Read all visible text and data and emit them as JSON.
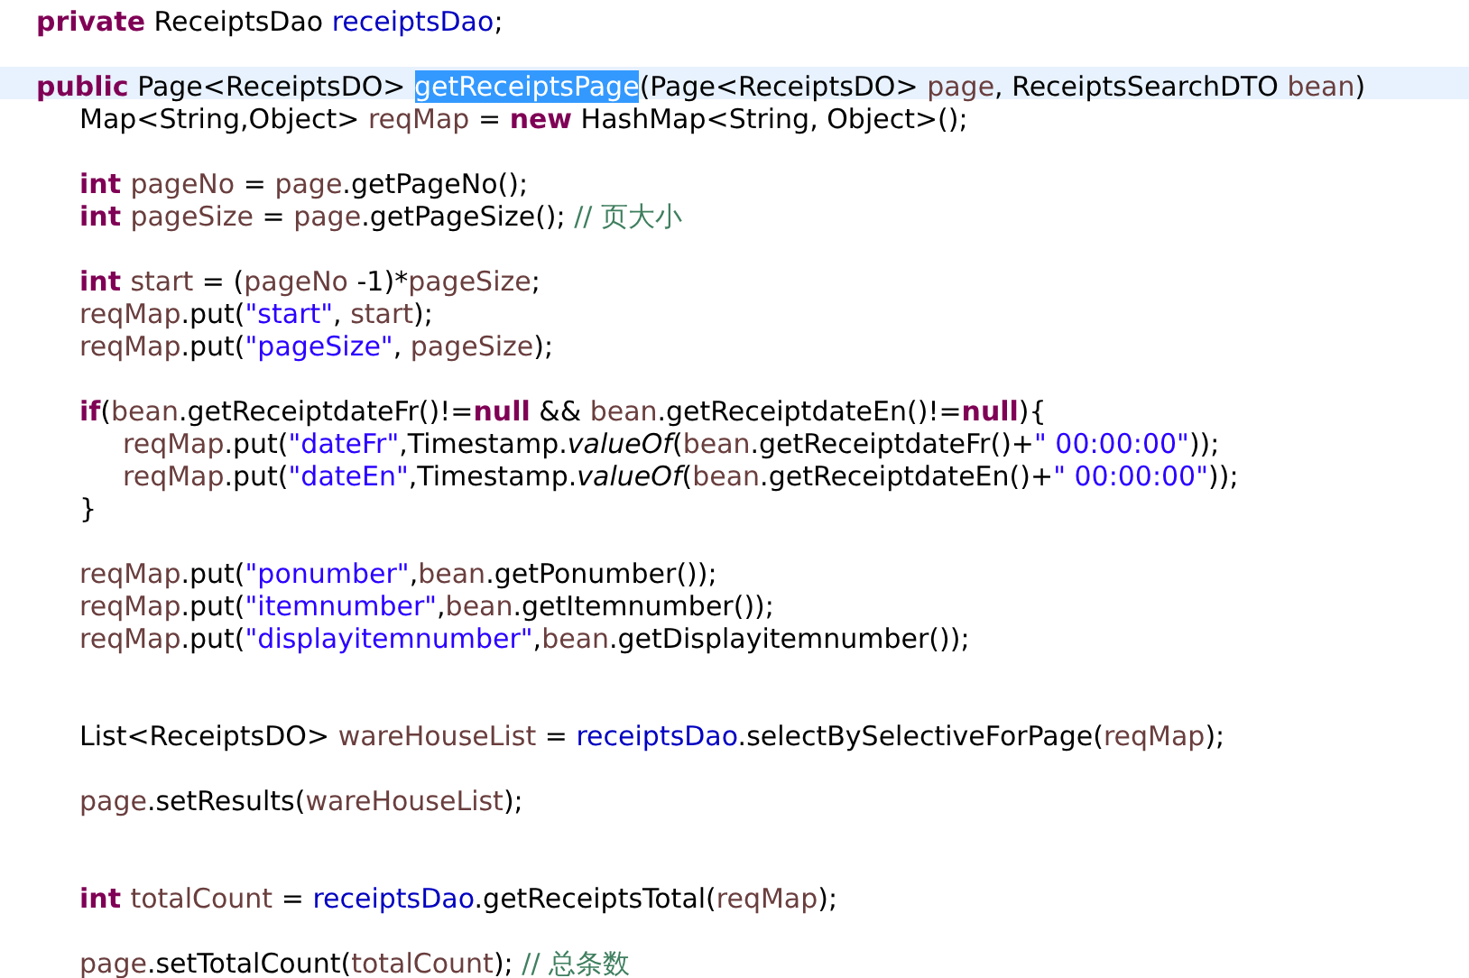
{
  "editor": {
    "lines": [
      {
        "kind": "code",
        "current": false,
        "tokens": [
          {
            "kind": "keyword",
            "text": "private"
          },
          {
            "kind": "plain",
            "text": " ReceiptsDao "
          },
          {
            "kind": "field",
            "text": "receiptsDao"
          },
          {
            "kind": "plain",
            "text": ";"
          }
        ]
      },
      {
        "kind": "blank"
      },
      {
        "kind": "code",
        "current": true,
        "tokens": [
          {
            "kind": "keyword",
            "text": "public"
          },
          {
            "kind": "plain",
            "text": " Page<ReceiptsDO> "
          },
          {
            "kind": "selected",
            "text": "getReceiptsPage"
          },
          {
            "kind": "plain",
            "text": "(Page<ReceiptsDO> "
          },
          {
            "kind": "local",
            "text": "page"
          },
          {
            "kind": "plain",
            "text": ", ReceiptsSearchDTO "
          },
          {
            "kind": "local",
            "text": "bean"
          },
          {
            "kind": "plain",
            "text": ")"
          }
        ],
        "children": [
          {
            "kind": "code",
            "current": false,
            "tokens": [
              {
                "kind": "plain",
                "text": "Map<String,Object> "
              },
              {
                "kind": "local",
                "text": "reqMap"
              },
              {
                "kind": "plain",
                "text": " = "
              },
              {
                "kind": "keyword",
                "text": "new"
              },
              {
                "kind": "plain",
                "text": " HashMap<String, Object>();"
              }
            ]
          },
          {
            "kind": "blank"
          },
          {
            "kind": "code",
            "current": false,
            "tokens": [
              {
                "kind": "keyword",
                "text": "int "
              },
              {
                "kind": "local",
                "text": "pageNo"
              },
              {
                "kind": "plain",
                "text": " = "
              },
              {
                "kind": "local",
                "text": "page"
              },
              {
                "kind": "plain",
                "text": ".getPageNo();"
              }
            ]
          },
          {
            "kind": "code",
            "current": false,
            "tokens": [
              {
                "kind": "keyword",
                "text": "int "
              },
              {
                "kind": "local",
                "text": "pageSize"
              },
              {
                "kind": "plain",
                "text": " = "
              },
              {
                "kind": "local",
                "text": "page"
              },
              {
                "kind": "plain",
                "text": ".getPageSize(); "
              },
              {
                "kind": "comment",
                "text": "// 页大小"
              }
            ]
          },
          {
            "kind": "blank"
          },
          {
            "kind": "code",
            "current": false,
            "tokens": [
              {
                "kind": "keyword",
                "text": "int "
              },
              {
                "kind": "local",
                "text": "start"
              },
              {
                "kind": "plain",
                "text": " = ("
              },
              {
                "kind": "local",
                "text": "pageNo"
              },
              {
                "kind": "plain",
                "text": " -1)*"
              },
              {
                "kind": "local",
                "text": "pageSize"
              },
              {
                "kind": "plain",
                "text": ";"
              }
            ]
          },
          {
            "kind": "code",
            "current": false,
            "tokens": [
              {
                "kind": "local",
                "text": "reqMap"
              },
              {
                "kind": "plain",
                "text": ".put("
              },
              {
                "kind": "string",
                "text": "\"start\""
              },
              {
                "kind": "plain",
                "text": ", "
              },
              {
                "kind": "local",
                "text": "start"
              },
              {
                "kind": "plain",
                "text": ");"
              }
            ]
          },
          {
            "kind": "code",
            "current": false,
            "tokens": [
              {
                "kind": "local",
                "text": "reqMap"
              },
              {
                "kind": "plain",
                "text": ".put("
              },
              {
                "kind": "string",
                "text": "\"pageSize\""
              },
              {
                "kind": "plain",
                "text": ", "
              },
              {
                "kind": "local",
                "text": "pageSize"
              },
              {
                "kind": "plain",
                "text": ");"
              }
            ]
          },
          {
            "kind": "blank"
          },
          {
            "kind": "code",
            "current": false,
            "tokens": [
              {
                "kind": "keyword",
                "text": "if"
              },
              {
                "kind": "plain",
                "text": "("
              },
              {
                "kind": "local",
                "text": "bean"
              },
              {
                "kind": "plain",
                "text": ".getReceiptdateFr()!="
              },
              {
                "kind": "keyword",
                "text": "null"
              },
              {
                "kind": "plain",
                "text": " && "
              },
              {
                "kind": "local",
                "text": "bean"
              },
              {
                "kind": "plain",
                "text": ".getReceiptdateEn()!="
              },
              {
                "kind": "keyword",
                "text": "null"
              },
              {
                "kind": "plain",
                "text": "){"
              }
            ],
            "children": [
              {
                "kind": "code",
                "current": false,
                "tokens": [
                  {
                    "kind": "local",
                    "text": "reqMap"
                  },
                  {
                    "kind": "plain",
                    "text": ".put("
                  },
                  {
                    "kind": "string",
                    "text": "\"dateFr\""
                  },
                  {
                    "kind": "plain",
                    "text": ",Timestamp."
                  },
                  {
                    "kind": "static",
                    "text": "valueOf"
                  },
                  {
                    "kind": "plain",
                    "text": "("
                  },
                  {
                    "kind": "local",
                    "text": "bean"
                  },
                  {
                    "kind": "plain",
                    "text": ".getReceiptdateFr()+"
                  },
                  {
                    "kind": "string",
                    "text": "\" 00:00:00\""
                  },
                  {
                    "kind": "plain",
                    "text": "));"
                  }
                ]
              },
              {
                "kind": "code",
                "current": false,
                "tokens": [
                  {
                    "kind": "local",
                    "text": "reqMap"
                  },
                  {
                    "kind": "plain",
                    "text": ".put("
                  },
                  {
                    "kind": "string",
                    "text": "\"dateEn\""
                  },
                  {
                    "kind": "plain",
                    "text": ",Timestamp."
                  },
                  {
                    "kind": "static",
                    "text": "valueOf"
                  },
                  {
                    "kind": "plain",
                    "text": "("
                  },
                  {
                    "kind": "local",
                    "text": "bean"
                  },
                  {
                    "kind": "plain",
                    "text": ".getReceiptdateEn()+"
                  },
                  {
                    "kind": "string",
                    "text": "\" 00:00:00\""
                  },
                  {
                    "kind": "plain",
                    "text": "));"
                  }
                ]
              }
            ]
          },
          {
            "kind": "code",
            "current": false,
            "tokens": [
              {
                "kind": "plain",
                "text": "}"
              }
            ]
          },
          {
            "kind": "blank"
          },
          {
            "kind": "code",
            "current": false,
            "tokens": [
              {
                "kind": "local",
                "text": "reqMap"
              },
              {
                "kind": "plain",
                "text": ".put("
              },
              {
                "kind": "string",
                "text": "\"ponumber\""
              },
              {
                "kind": "plain",
                "text": ","
              },
              {
                "kind": "local",
                "text": "bean"
              },
              {
                "kind": "plain",
                "text": ".getPonumber());"
              }
            ]
          },
          {
            "kind": "code",
            "current": false,
            "tokens": [
              {
                "kind": "local",
                "text": "reqMap"
              },
              {
                "kind": "plain",
                "text": ".put("
              },
              {
                "kind": "string",
                "text": "\"itemnumber\""
              },
              {
                "kind": "plain",
                "text": ","
              },
              {
                "kind": "local",
                "text": "bean"
              },
              {
                "kind": "plain",
                "text": ".getItemnumber());"
              }
            ]
          },
          {
            "kind": "code",
            "current": false,
            "tokens": [
              {
                "kind": "local",
                "text": "reqMap"
              },
              {
                "kind": "plain",
                "text": ".put("
              },
              {
                "kind": "string",
                "text": "\"displayitemnumber\""
              },
              {
                "kind": "plain",
                "text": ","
              },
              {
                "kind": "local",
                "text": "bean"
              },
              {
                "kind": "plain",
                "text": ".getDisplayitemnumber());"
              }
            ]
          },
          {
            "kind": "blank"
          },
          {
            "kind": "blank"
          },
          {
            "kind": "code",
            "current": false,
            "tokens": [
              {
                "kind": "plain",
                "text": "List<ReceiptsDO> "
              },
              {
                "kind": "local",
                "text": "wareHouseList"
              },
              {
                "kind": "plain",
                "text": " = "
              },
              {
                "kind": "field",
                "text": "receiptsDao"
              },
              {
                "kind": "plain",
                "text": ".selectBySelectiveForPage("
              },
              {
                "kind": "local",
                "text": "reqMap"
              },
              {
                "kind": "plain",
                "text": ");"
              }
            ]
          },
          {
            "kind": "blank"
          },
          {
            "kind": "code",
            "current": false,
            "tokens": [
              {
                "kind": "local",
                "text": "page"
              },
              {
                "kind": "plain",
                "text": ".setResults("
              },
              {
                "kind": "local",
                "text": "wareHouseList"
              },
              {
                "kind": "plain",
                "text": ");"
              }
            ]
          },
          {
            "kind": "blank"
          },
          {
            "kind": "blank"
          },
          {
            "kind": "code",
            "current": false,
            "tokens": [
              {
                "kind": "keyword",
                "text": "int "
              },
              {
                "kind": "local",
                "text": "totalCount"
              },
              {
                "kind": "plain",
                "text": " = "
              },
              {
                "kind": "field",
                "text": "receiptsDao"
              },
              {
                "kind": "plain",
                "text": ".getReceiptsTotal("
              },
              {
                "kind": "local",
                "text": "reqMap"
              },
              {
                "kind": "plain",
                "text": ");"
              }
            ]
          },
          {
            "kind": "blank"
          },
          {
            "kind": "code",
            "current": false,
            "tokens": [
              {
                "kind": "local",
                "text": "page"
              },
              {
                "kind": "plain",
                "text": ".setTotalCount("
              },
              {
                "kind": "local",
                "text": "totalCount"
              },
              {
                "kind": "plain",
                "text": "); "
              },
              {
                "kind": "comment",
                "text": "// 总条数"
              }
            ]
          }
        ]
      }
    ]
  }
}
